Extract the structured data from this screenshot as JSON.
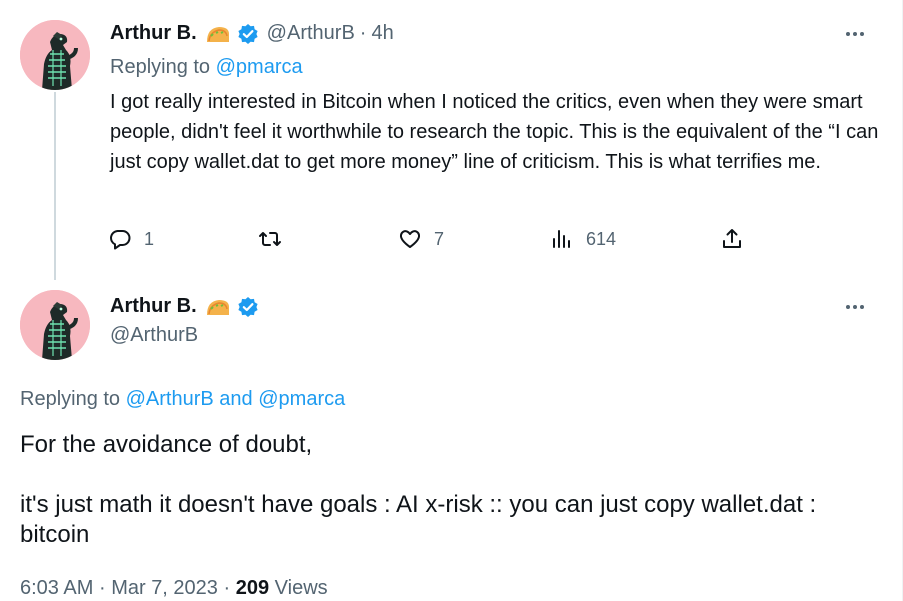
{
  "tweet1": {
    "author_name": "Arthur B.",
    "handle": "@ArthurB",
    "separator": "·",
    "time": "4h",
    "replying_label": "Replying to",
    "replying_to": "@pmarca",
    "text": "I got really interested in Bitcoin when I noticed the critics, even when they were smart people, didn't feel it worthwhile to research the topic. This is the equivalent of the “I can just copy wallet.dat to get more money” line of criticism. This is what terrifies me.",
    "actions": {
      "replies": "1",
      "retweets": "",
      "likes": "7",
      "views": "614"
    },
    "icons": [
      "taco-emoji-icon",
      "verified-badge-icon",
      "more-options-icon",
      "reply-icon",
      "retweet-icon",
      "like-icon",
      "views-icon",
      "share-icon"
    ]
  },
  "tweet2": {
    "author_name": "Arthur B.",
    "handle": "@ArthurB",
    "replying_label": "Replying to",
    "replying_to_1": "@ArthurB",
    "replying_and": "and",
    "replying_to_2": "@pmarca",
    "text_line1": "For the avoidance of doubt,",
    "text_line2": "it's just math it doesn't have goals : AI x-risk :: you can just copy wallet.dat : bitcoin",
    "meta_time": "6:03 AM",
    "meta_sep1": "·",
    "meta_date": "Mar 7, 2023",
    "meta_sep2": "·",
    "views_count": "209",
    "views_label": "Views"
  },
  "colors": {
    "link": "#1d9bf0",
    "secondary_text": "#536471",
    "primary_text": "#0f1419",
    "verified": "#1d9bf0",
    "avatar_bg": "#f7b8bf"
  }
}
